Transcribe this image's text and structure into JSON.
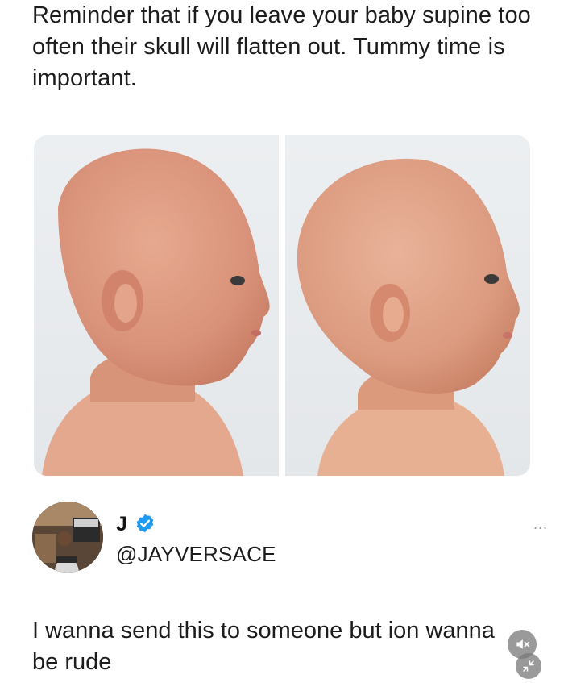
{
  "post": {
    "caption": "Reminder that if you leave your baby supine too often their skull will flatten out. Tummy time is important."
  },
  "photos": [
    {
      "icon": "baby-profile-photo",
      "side": "left"
    },
    {
      "icon": "baby-profile-photo",
      "side": "right"
    }
  ],
  "tweet": {
    "display_name": "J",
    "handle": "@JAYVERSACE",
    "verified_icon": "verified-badge-icon",
    "more_label": "...",
    "text": "I wanna send this to someone but ion wanna be rude"
  },
  "controls": {
    "mute_icon": "speaker-muted-icon",
    "collapse_icon": "collapse-arrows-icon"
  },
  "colors": {
    "verified": "#1d9bf0",
    "background": "#ffffff",
    "text": "#1c1c1c"
  }
}
